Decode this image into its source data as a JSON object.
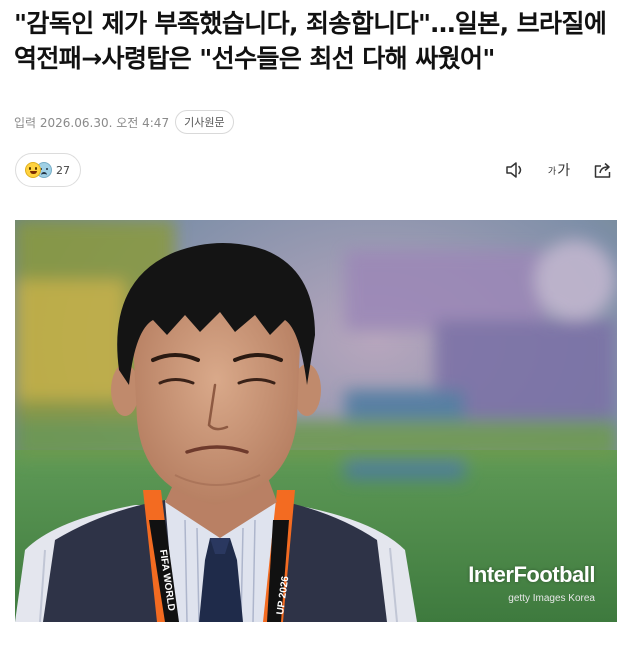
{
  "article": {
    "headline": "\"감독인 제가 부족했습니다, 죄송합니다\"…일본, 브라질에 역전패→사령탑은 \"선수들은 최선 다해 싸웠어\"",
    "date_line": "입력 2026.06.30. 오전 4:47",
    "original_link_label": "기사원문"
  },
  "reactions": {
    "count": "27",
    "icons": [
      "smile-emoji",
      "sad-emoji"
    ]
  },
  "toolbar": {
    "audio_icon": "speaker-icon",
    "font_small": "가",
    "font_large": "가",
    "share_icon": "share-icon"
  },
  "photo": {
    "watermark_brand": "InterFootball",
    "watermark_credit": "getty Images Korea",
    "lanyard_text_left": "FIFA WORLD",
    "lanyard_text_right": "UP 2026"
  }
}
